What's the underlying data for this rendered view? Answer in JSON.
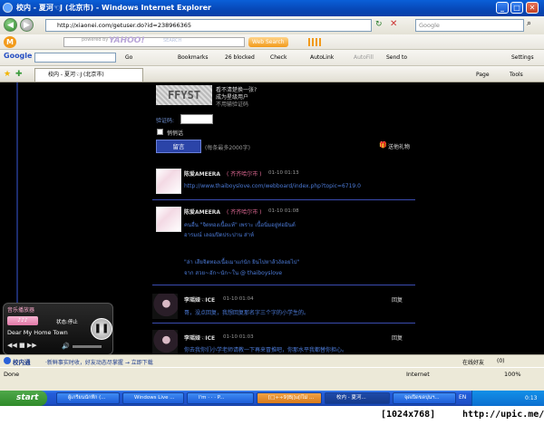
{
  "window": {
    "title": "校内 - 夏河☜J (北京市) - Windows Internet Explorer",
    "min": "_",
    "max": "□",
    "close": "✕"
  },
  "address": {
    "url": "http://xiaonei.com/getuser.do?id=238966365",
    "search_placeholder": "Google"
  },
  "yahoo": {
    "logo": "YAHOO!",
    "powered": "powered by",
    "search_hint": "SEARCH",
    "web_search": "Web Search"
  },
  "google_bar": {
    "logo": "Google",
    "go": "Go",
    "bookmarks": "Bookmarks",
    "blocked": "26 blocked",
    "check": "Check",
    "autolink": "AutoLink",
    "autofill": "AutoFill",
    "sendto": "Send to",
    "settings": "Settings"
  },
  "tab": {
    "label": "校内 - 夏河☜J (北京市)",
    "page": "Page",
    "tools": "Tools"
  },
  "captcha": {
    "image_text": "FFYST",
    "hint1": "看不清楚换一张?",
    "hint2": "成为星级用户",
    "hint3": "不用输验证码",
    "label": "验证码:"
  },
  "form": {
    "whisper": "悄悄话",
    "submit": "留言",
    "limit": "(每条最多2000字)",
    "gift": "送他礼物"
  },
  "comments": [
    {
      "name": "陈爱AMEERA",
      "loc": "( 齐齐哈尔市 )",
      "time": "01-10 01:13",
      "text": "http://www.thaiboyslove.com/webboard/index.php?topic=6719.0"
    },
    {
      "name": "陈爱AMEERA",
      "loc": "( 齐齐哈尔市 )",
      "time": "01-10 01:08",
      "line1": "คนอื่น \"จิตทองเนื้อแท้\" เพราะ เนื้อนิ่มอยู่ท่อมินต์",
      "line2": "อารมณ์ เลอมปิดประปาน ส่าห์",
      "line3": "\"ล่า เสียจิตทองเนื้อเมาแก่นัก ยินไปหาส้วงัลอยไป\"",
      "line4": "จาก สวย~อัก~นัก~ใน @ thaiboyslove"
    },
    {
      "name": "李瑶娅☜ICE",
      "time": "01-10 01:04",
      "reply": "回复",
      "text": "哥，没点回复，我想回复那名字三个字的小学生的。"
    },
    {
      "name": "李瑶娅☜ICE",
      "time": "01-10 01:03",
      "reply": "回复",
      "text": "你去我你们小学老师请教一下再来冒推吧，你那水平我都替你担心。"
    }
  ],
  "music": {
    "title": "音乐播放器",
    "state": "状态:停止",
    "song": "Dear My Home Town"
  },
  "status_tip": {
    "site": "校内通",
    "msg": "·新鲜事实时收，好友动态尽掌握 → 立即下载",
    "online": "在线好友",
    "count": "(0)"
  },
  "ie_status": {
    "left": "Done",
    "zone": "Internet",
    "zoom": "100%"
  },
  "taskbar": {
    "start": "start",
    "tasks": [
      "ผู้เกรียนนักทึก (...",
      "Windows Live ...",
      "I'm · · · P...",
      "[□÷÷9]Bj]u[iไม่ ...",
      "校内 - 夏河...",
      "จุดเปิดขดปุนฯ..."
    ],
    "lang": "EN",
    "clock": "0:13"
  },
  "footer": {
    "resolution": "[1024x768]",
    "site": "http://upic.me/"
  }
}
